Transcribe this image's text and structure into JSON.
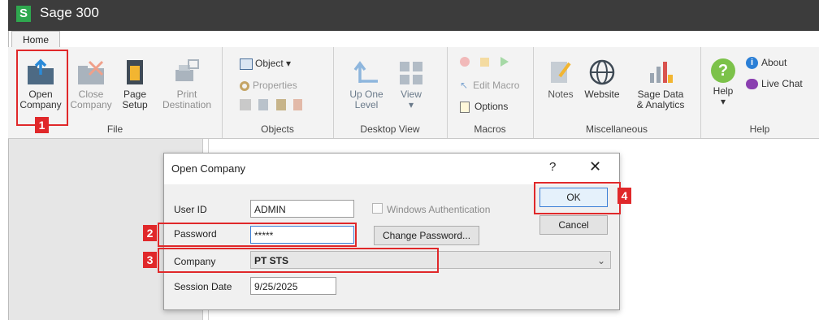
{
  "app": {
    "title": "Sage 300",
    "logo": "S"
  },
  "tabs": {
    "home": "Home"
  },
  "ribbon": {
    "file": {
      "label": "File",
      "open_company": [
        "Open",
        "Company"
      ],
      "close_company": [
        "Close",
        "Company"
      ],
      "page_setup": [
        "Page",
        "Setup"
      ],
      "print_destination": [
        "Print",
        "Destination"
      ]
    },
    "objects": {
      "label": "Objects",
      "object": "Object ▾",
      "properties": "Properties"
    },
    "desktop_view": {
      "label": "Desktop View",
      "up_one_level": [
        "Up One",
        "Level"
      ],
      "view": "View"
    },
    "macros": {
      "label": "Macros",
      "edit_macro": "Edit Macro",
      "options": "Options"
    },
    "misc": {
      "label": "Miscellaneous",
      "notes": "Notes",
      "website": "Website",
      "sage_data": [
        "Sage Data",
        "& Analytics"
      ]
    },
    "help": {
      "label": "Help",
      "help_btn": "Help",
      "about": "About",
      "live_chat": "Live Chat"
    }
  },
  "dialog": {
    "title": "Open Company",
    "help_glyph": "?",
    "close_glyph": "✕",
    "user_id_label": "User ID",
    "user_id_value": "ADMIN",
    "windows_auth_label": "Windows Authentication",
    "password_label": "Password",
    "password_value": "*****",
    "change_password": "Change Password...",
    "company_label": "Company",
    "company_value": "PT STS",
    "session_date_label": "Session Date",
    "session_date_value": "9/25/2025",
    "ok": "OK",
    "cancel": "Cancel"
  },
  "annotations": {
    "step1": "1",
    "step2": "2",
    "step3": "3",
    "step4": "4"
  },
  "colors": {
    "highlight": "#e0282a",
    "titlebar": "#3c3c3c",
    "brand": "#2fa84f",
    "ok_border": "#3c7fd6"
  }
}
